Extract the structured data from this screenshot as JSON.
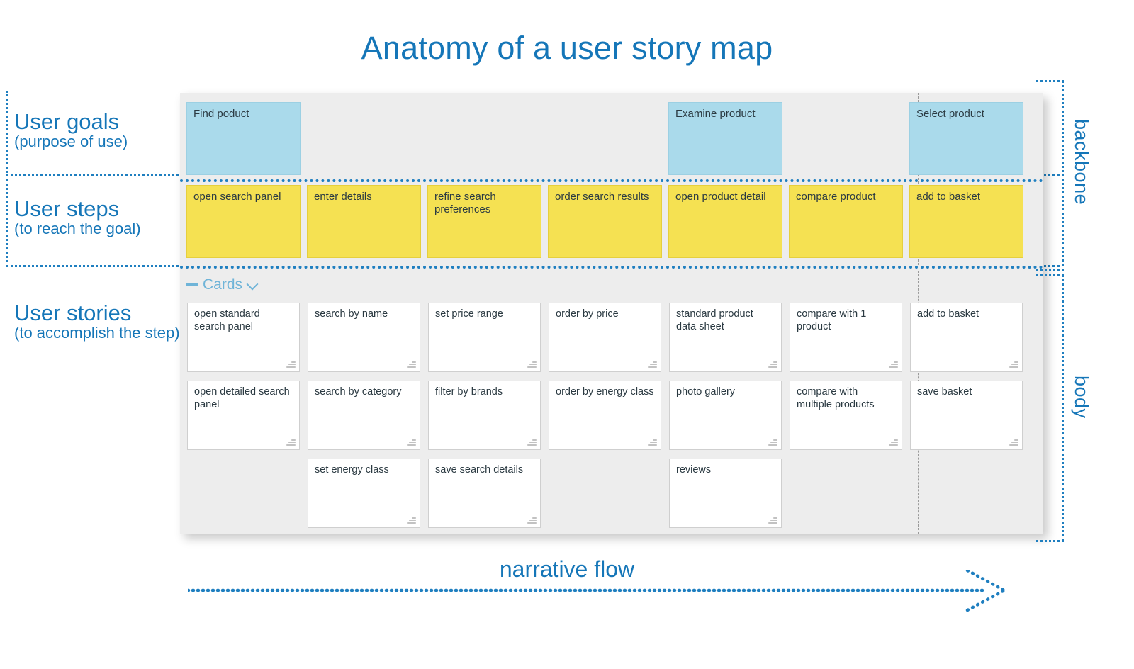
{
  "title": "Anatomy of a user story map",
  "colors": {
    "accent_blue": "#1576b8",
    "goal_card": "#aadaeb",
    "step_card": "#f5e152",
    "board_bg": "#ededed",
    "story_card": "#ffffff",
    "cards_header": "#6fb4d8"
  },
  "left_labels": [
    {
      "id": "goals",
      "big": "User goals",
      "small": "(purpose of use)"
    },
    {
      "id": "steps",
      "big": "User steps",
      "small": "(to reach the goal)"
    },
    {
      "id": "stories",
      "big": "User stories",
      "small": "(to accomplish the step)"
    }
  ],
  "right_labels": {
    "backbone": "backbone",
    "body": "body"
  },
  "cards_section": {
    "label": "Cards",
    "collapse_icon": "minus-icon",
    "expand_icon": "chevron-down-icon"
  },
  "narrative": {
    "label": "narrative flow",
    "arrow_icon": "arrow-right-dotted-icon"
  },
  "board": {
    "goals": [
      {
        "column": 0,
        "label": "Find poduct"
      },
      {
        "column": 4,
        "label": "Examine product"
      },
      {
        "column": 6,
        "label": "Select product"
      }
    ],
    "steps": [
      "open search panel",
      "enter details",
      "refine search preferences",
      "order search results",
      "open product detail",
      "compare product",
      "add to basket"
    ],
    "stories": [
      [
        "open standard search panel",
        "open detailed search panel",
        ""
      ],
      [
        "search by name",
        "search by category",
        "set energy class"
      ],
      [
        "set price range",
        "filter by brands",
        "save search details"
      ],
      [
        "order by price",
        "order by energy class",
        ""
      ],
      [
        "standard product data sheet",
        "photo gallery",
        "reviews"
      ],
      [
        "compare with 1 product",
        "compare with multiple products",
        ""
      ],
      [
        "add to basket",
        "save basket",
        ""
      ]
    ]
  }
}
